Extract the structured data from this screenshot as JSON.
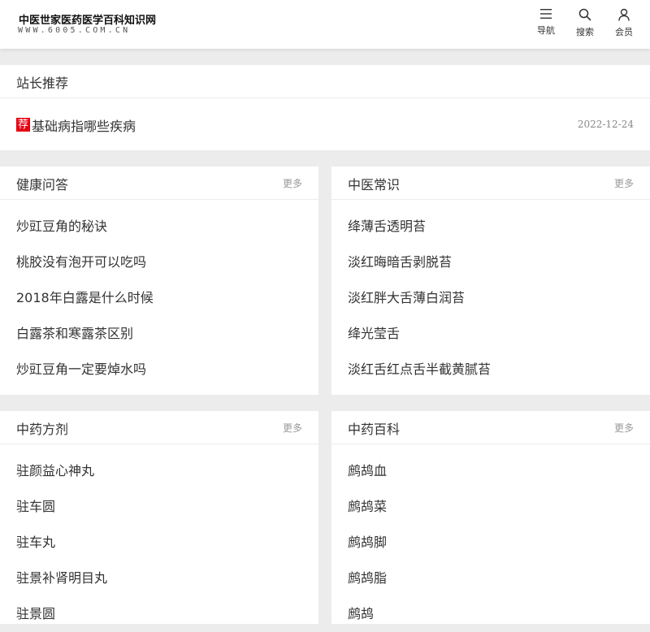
{
  "header": {
    "site_title": "中医世家医药医学百科知识网",
    "site_url": "WWW.6005.COM.CN",
    "nav": {
      "label": "导航",
      "icon": "menu-icon"
    },
    "search": {
      "label": "搜索",
      "icon": "search-icon"
    },
    "member": {
      "label": "会员",
      "icon": "user-icon"
    }
  },
  "recommend": {
    "title": "站长推荐",
    "badge": "荐",
    "item": {
      "title": "基础病指哪些疾病",
      "date": "2022-12-24"
    }
  },
  "sections": [
    {
      "title": "健康问答",
      "more": "更多",
      "items": [
        "炒豇豆角的秘诀",
        "桃胶没有泡开可以吃吗",
        "2018年白露是什么时候",
        "白露茶和寒露茶区别",
        "炒豇豆角一定要焯水吗"
      ]
    },
    {
      "title": "中医常识",
      "more": "更多",
      "items": [
        "绛薄舌透明苔",
        "淡红晦暗舌剥脱苔",
        "淡红胖大舌薄白润苔",
        "绛光莹舌",
        "淡红舌红点舌半截黄腻苔"
      ]
    },
    {
      "title": "中药方剂",
      "more": "更多",
      "items": [
        "驻颜益心神丸",
        "驻车圆",
        "驻车丸",
        "驻景补肾明目丸",
        "驻景圆"
      ]
    },
    {
      "title": "中药百科",
      "more": "更多",
      "items": [
        "鹧鸪血",
        "鹧鸪菜",
        "鹧鸪脚",
        "鹧鸪脂",
        "鹧鸪"
      ]
    }
  ],
  "colors": {
    "badge": "#e60012",
    "background": "#ececec"
  }
}
